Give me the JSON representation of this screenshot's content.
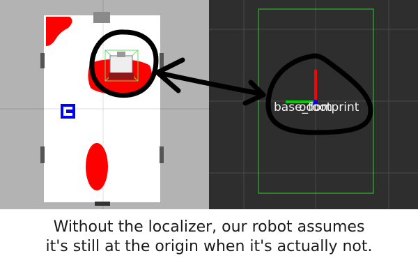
{
  "caption": {
    "line1": "Without the localizer, our robot assumes",
    "line2": "it's still at the origin when it's actually not."
  },
  "rviz": {
    "frame_label": "base_footprint",
    "frame_label_overlap": "odom"
  },
  "colors": {
    "sim_background": "#b3b3b3",
    "map_floor": "#ffffff",
    "obstacle": "#ff0000",
    "marker": "#0000ff",
    "rviz_background": "#2e2e2e",
    "rviz_grid": "#4a4a4a",
    "bounds_outline": "#33cc33",
    "axis_x": "#ff0000",
    "axis_y": "#00cc00",
    "axis_z": "#0000ff",
    "annotation_ink": "#000000"
  }
}
